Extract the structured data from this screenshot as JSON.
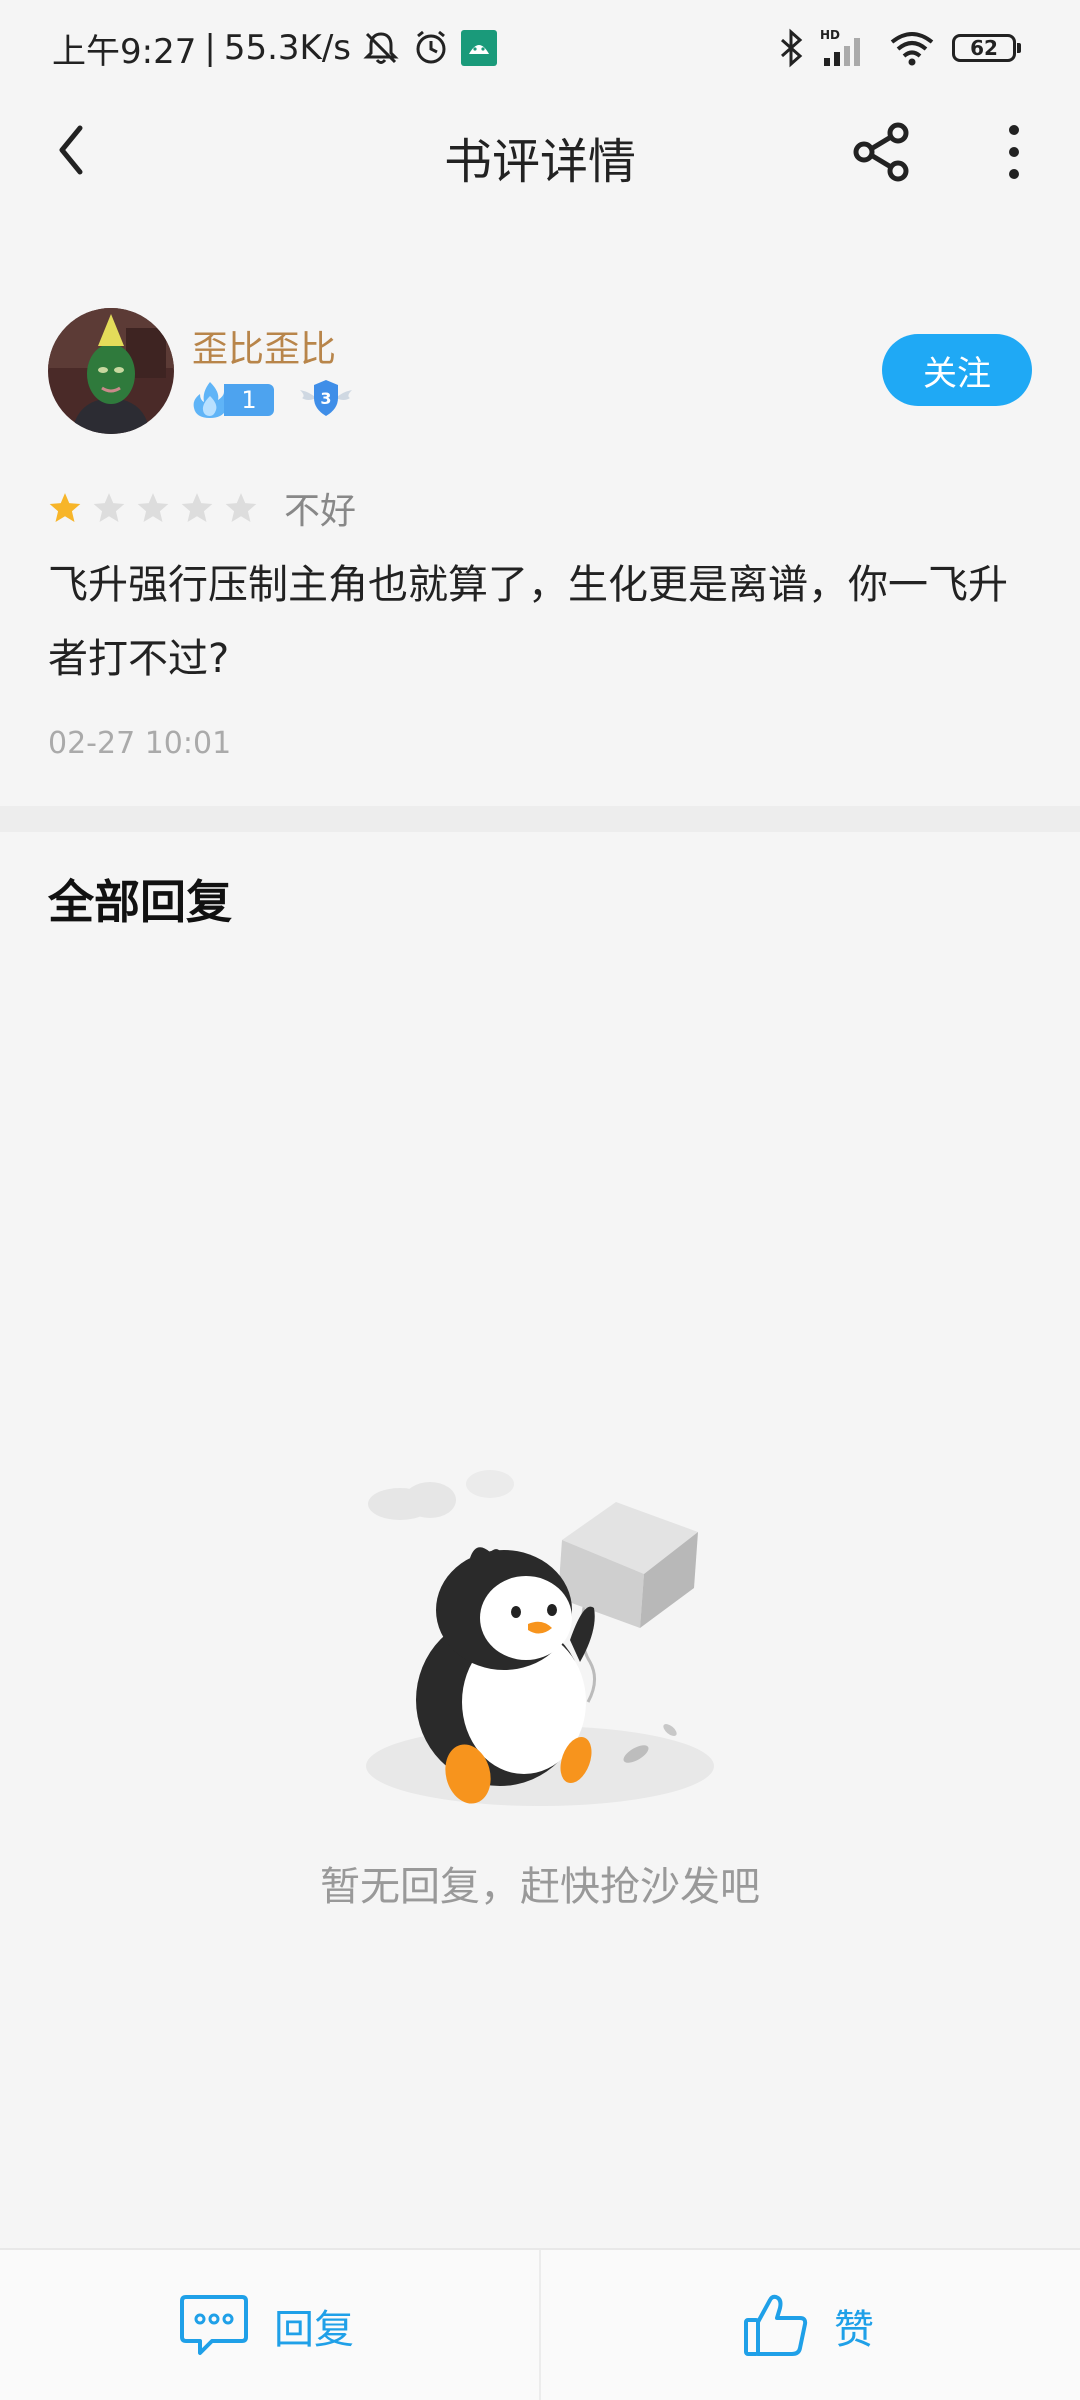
{
  "status_bar": {
    "time": "上午9:27",
    "separator": "|",
    "speed": "55.3K/s",
    "battery": "62",
    "network_label": "HD"
  },
  "header": {
    "title": "书评详情"
  },
  "review": {
    "username": "歪比歪比",
    "fan_level": "1",
    "rank_level": "3",
    "follow_label": "关注",
    "rating": 1,
    "rating_max": 5,
    "rating_label": "不好",
    "content": "飞升强行压制主角也就算了，生化更是离谱，你一飞升者打不过?",
    "time": "02-27 10:01"
  },
  "replies": {
    "heading": "全部回复",
    "empty_text": "暂无回复，赶快抢沙发吧"
  },
  "bottom_bar": {
    "reply_label": "回复",
    "like_label": "赞"
  },
  "colors": {
    "accent": "#1fa9f5",
    "username": "#b8854a",
    "star_active": "#f7b529",
    "star_inactive": "#dddddd"
  }
}
